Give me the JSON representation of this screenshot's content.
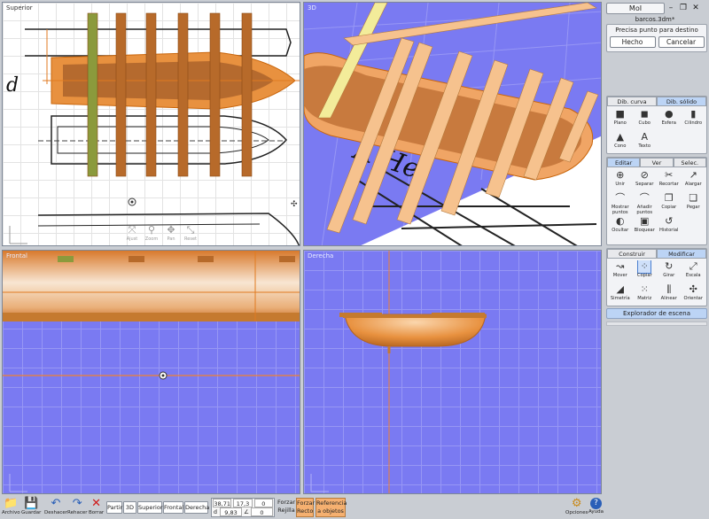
{
  "window": {
    "app_name": "MoI",
    "filename": "barcos.3dm*",
    "min_icon": "minimize-icon",
    "restore_icon": "restore-icon",
    "close_icon": "close-icon"
  },
  "viewports": {
    "superior": {
      "title": "Superior",
      "sheet_letter": "d"
    },
    "perspective": {
      "title": "3D",
      "sheet_letters": "A He"
    },
    "frontal": {
      "title": "Frontal"
    },
    "derecha": {
      "title": "Derecha"
    },
    "nav": [
      {
        "label": "Ajust",
        "icon": "zoom-extents-icon"
      },
      {
        "label": "Zoom",
        "icon": "zoom-icon"
      },
      {
        "label": "Pan",
        "icon": "pan-icon"
      },
      {
        "label": "Reset",
        "icon": "reset-view-icon"
      }
    ]
  },
  "prompt": {
    "text": "Precisa punto para destino",
    "done": "Hecho",
    "cancel": "Cancelar"
  },
  "draw_panel": {
    "tabs": [
      "Dib. curva",
      "Dib. sólido"
    ],
    "active_tab": 1,
    "tools": [
      {
        "label": "Plano",
        "glyph": "■"
      },
      {
        "label": "Cubo",
        "glyph": "◼"
      },
      {
        "label": "Esfera",
        "glyph": "●"
      },
      {
        "label": "Cilindro",
        "glyph": "▮"
      },
      {
        "label": "Cono",
        "glyph": "▲"
      },
      {
        "label": "Texto",
        "glyph": "A"
      }
    ]
  },
  "edit_panel": {
    "tabs": [
      "Editar",
      "Ver",
      "Selec."
    ],
    "active_tab": 0,
    "tools": [
      {
        "label": "Unir",
        "glyph": "⊕"
      },
      {
        "label": "Separar",
        "glyph": "⊘"
      },
      {
        "label": "Recortar",
        "glyph": "✂"
      },
      {
        "label": "Alargar",
        "glyph": "↗"
      },
      {
        "label": "Mostrar puntos",
        "glyph": "⌒"
      },
      {
        "label": "Añadir puntos",
        "glyph": "⌒"
      },
      {
        "label": "Copiar",
        "glyph": "❐"
      },
      {
        "label": "Pegar",
        "glyph": "❏"
      },
      {
        "label": "Ocultar",
        "glyph": "◐"
      },
      {
        "label": "Bloquear",
        "glyph": "▣"
      },
      {
        "label": "Historial",
        "glyph": "↺"
      }
    ]
  },
  "transform_panel": {
    "tabs": [
      "Construir",
      "Modificar"
    ],
    "active_tab": 1,
    "selected_index": 1,
    "tools": [
      {
        "label": "Mover",
        "glyph": "↝"
      },
      {
        "label": "Copiar",
        "glyph": "⁘"
      },
      {
        "label": "Girar",
        "glyph": "↻"
      },
      {
        "label": "Escala",
        "glyph": "⤢"
      },
      {
        "label": "Simetría",
        "glyph": "◢"
      },
      {
        "label": "Matriz",
        "glyph": "⁙"
      },
      {
        "label": "Alinear",
        "glyph": "⫼"
      },
      {
        "label": "Orientar",
        "glyph": "✣"
      }
    ]
  },
  "scene_browser": "Explorador de escena",
  "bottom": {
    "files": [
      {
        "label": "Archivo",
        "glyph": "📁"
      },
      {
        "label": "Guardar",
        "glyph": "💾"
      }
    ],
    "undo": {
      "label": "Deshacer",
      "glyph": "↶"
    },
    "redo": {
      "label": "Rehacer",
      "glyph": "↷"
    },
    "delete": {
      "label": "Borrar",
      "glyph": "✕"
    },
    "views": [
      "Partir",
      "3D",
      "Superior",
      "Frontal",
      "Derecha"
    ],
    "coords": {
      "x": "38,71",
      "y": "17,3",
      "z": "0",
      "dist_label": "d",
      "dist": "9,83",
      "angle_label": "∠",
      "angle": "0"
    },
    "snap_labels": [
      {
        "line1": "Forzar",
        "line2": "Rejilla"
      }
    ],
    "snap_buttons": [
      {
        "line1": "Forzar",
        "line2": "Recto"
      },
      {
        "line1": "Referencia",
        "line2": "a objetos"
      }
    ],
    "options": {
      "label": "Opciones",
      "glyph": "⚙"
    },
    "help": {
      "label": "Ayuda",
      "glyph": "?"
    }
  },
  "colors": {
    "hull": "#e8913f",
    "frame": "#c57a2f",
    "viewport_blue": "#7a7af2",
    "panel_bg": "#c9cdd3",
    "active_tab": "#bcd4f5",
    "snap_on": "#f5b070"
  }
}
